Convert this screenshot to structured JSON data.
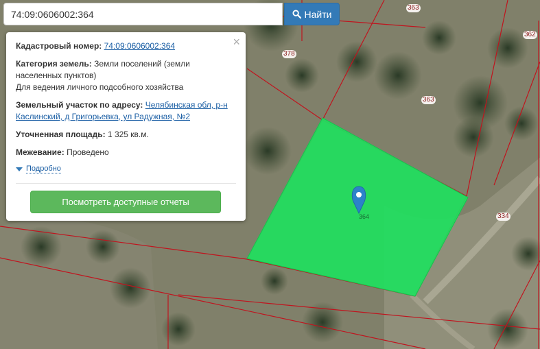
{
  "search": {
    "value": "74:09:0606002:364",
    "button_label": "Найти",
    "button_icon": "search-icon"
  },
  "popup": {
    "cadastral_label": "Кадастровый номер:",
    "cadastral_number": "74:09:0606002:364",
    "category_label": "Категория земель:",
    "category_value_1": "Земли поселений (земли",
    "category_value_2": "населенных пунктов)",
    "category_purpose": "Для ведения личного подсобного хозяйства",
    "address_label": "Земельный участок по адресу:",
    "address_line_1": "Челябинская обл, р-н",
    "address_line_2": "Каслинский, д Григорьевка, ул Радужная, №2",
    "area_label": "Уточненная площадь:",
    "area_value": "1 325 кв.м.",
    "survey_label": "Межевание:",
    "survey_value": "Проведено",
    "more_label": "Подробно",
    "reports_button": "Посмотреть доступные отчеты",
    "close_icon": "close-icon"
  },
  "map": {
    "plot_labels": [
      "363",
      "362",
      "378",
      "363",
      "334",
      "364"
    ],
    "highlight_color": "#1fe05e",
    "boundary_color": "#c0141e",
    "marker_color": "#2c82c9"
  }
}
